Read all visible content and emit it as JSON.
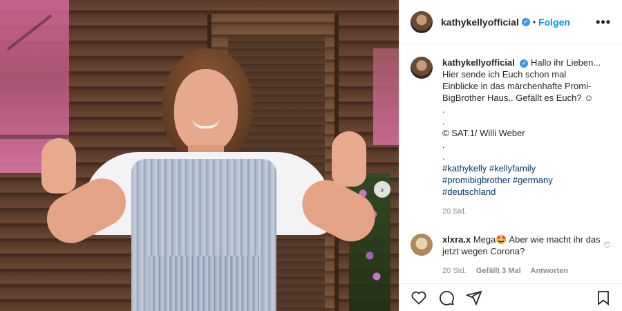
{
  "post": {
    "username": "kathykellyofficial",
    "verified_mark": "✓",
    "separator": "•",
    "follow_label": "Folgen",
    "more_icon": "•••",
    "caption_lines": [
      "Hallo ihr Lieben...",
      "Hier sende ich Euch schon mal",
      "Einblicke in das märchenhafte Promi-",
      "BigBrother Haus.. Gefällt es Euch? ☺",
      ".",
      ".",
      "© SAT.1/ Willi Weber",
      ".",
      ".",
      "#kathykelly #kellyfamily",
      "#promibigbrother #germany",
      "#deutschland"
    ],
    "caption_time": "20 Std."
  },
  "reply": {
    "username": "xlxra.x",
    "text": "Mega🤩 Aber wie macht ihr das jetzt wegen Corona?",
    "time": "20 Std.",
    "likes": "Gefällt 3 Mal",
    "reply_label": "Antworten",
    "heart_icon": "♡"
  },
  "carousel": {
    "next_icon": "›"
  },
  "colors": {
    "link": "#0095f6",
    "hashtag": "#00376b",
    "muted": "#8e8e8e",
    "verified": "#3897f0"
  },
  "icons": [
    "heart-icon",
    "comment-icon",
    "share-icon",
    "bookmark-icon"
  ]
}
